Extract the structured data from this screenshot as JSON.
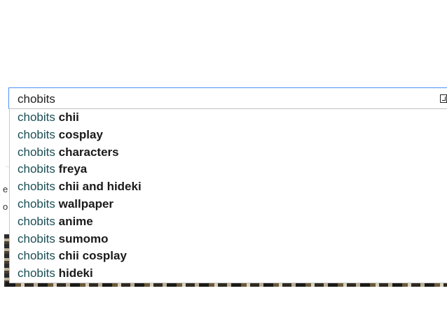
{
  "search": {
    "query": "chobits"
  },
  "suggestions": [
    {
      "prefix": "chobits",
      "completion": "chii"
    },
    {
      "prefix": "chobits",
      "completion": "cosplay"
    },
    {
      "prefix": "chobits",
      "completion": "characters"
    },
    {
      "prefix": "chobits",
      "completion": "freya"
    },
    {
      "prefix": "chobits",
      "completion": "chii and hideki"
    },
    {
      "prefix": "chobits",
      "completion": "wallpaper"
    },
    {
      "prefix": "chobits",
      "completion": "anime"
    },
    {
      "prefix": "chobits",
      "completion": "sumomo"
    },
    {
      "prefix": "chobits",
      "completion": "chii cosplay"
    },
    {
      "prefix": "chobits",
      "completion": "hideki"
    }
  ],
  "background": {
    "left_fragment_1": "e",
    "left_fragment_2": "o"
  },
  "colors": {
    "focus_border": "#4d90fe",
    "query_text": "#1a4e55",
    "completion_text": "#1a1a1a"
  },
  "icons": {
    "keyboard": "keyboard-icon"
  }
}
